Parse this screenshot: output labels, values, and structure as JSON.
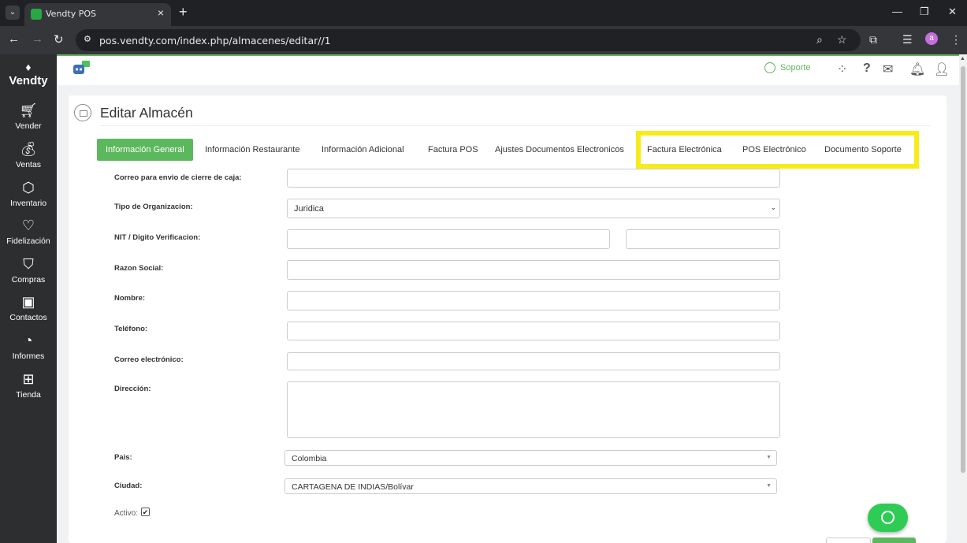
{
  "browser": {
    "tab_title": "Vendty POS",
    "url": "pos.vendty.com/index.php/almacenes/editar//1",
    "profile_initial": "a"
  },
  "sidebar": {
    "brand": "Vendty",
    "items": [
      {
        "label": "Vender",
        "icon": "cart-icon"
      },
      {
        "label": "Ventas",
        "icon": "money-bag-icon"
      },
      {
        "label": "Inventario",
        "icon": "box-icon"
      },
      {
        "label": "Fidelización",
        "icon": "heart-icon"
      },
      {
        "label": "Compras",
        "icon": "shopping-bag-icon"
      },
      {
        "label": "Contactos",
        "icon": "contacts-book-icon"
      },
      {
        "label": "Informes",
        "icon": "pie-chart-icon"
      },
      {
        "label": "Tienda",
        "icon": "store-icon"
      }
    ]
  },
  "header": {
    "support_label": "Soporte",
    "accent_color": "#62b35f"
  },
  "page": {
    "title": "Editar Almacén",
    "tabs": [
      {
        "label": "Información General",
        "active": true
      },
      {
        "label": "Información Restaurante"
      },
      {
        "label": "Información Adicional"
      },
      {
        "label": "Factura POS"
      },
      {
        "label": "Ajustes Documentos Electronicos"
      },
      {
        "label": "Factura Electrónica"
      },
      {
        "label": "POS Electrónico"
      },
      {
        "label": "Documento Soporte"
      }
    ]
  },
  "form": {
    "correo_cierre_label": "Correo para envio de cierre de caja:",
    "tipo_org_label": "Tipo de Organizacion:",
    "tipo_org_value": "Juridica",
    "nit_label": "NIT / Digito Verificacion:",
    "razon_social_label": "Razon Social:",
    "nombre_label": "Nombre:",
    "telefono_label": "Teléfono:",
    "correo_label": "Correo electrónico:",
    "direccion_label": "Dirección:",
    "pais_label": "Pais:",
    "pais_value": "Colombia",
    "ciudad_label": "Ciudad:",
    "ciudad_value": "CARTAGENA DE INDIAS/Bolívar",
    "activo_label": "Activo:",
    "activo_checked": true
  }
}
